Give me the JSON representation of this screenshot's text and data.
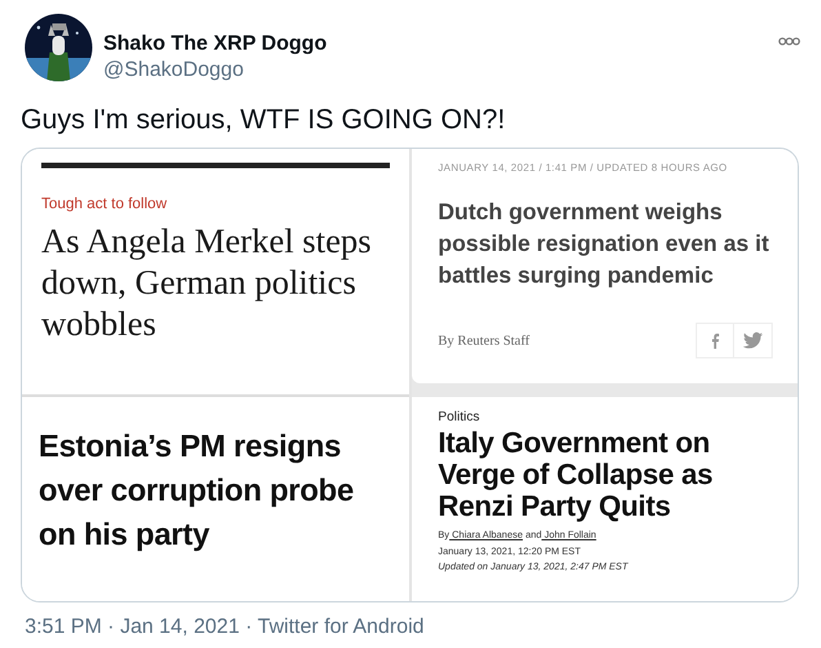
{
  "author": {
    "name": "Shako The XRP Doggo",
    "handle": "@ShakoDoggo"
  },
  "text": "Guys I'm serious, WTF IS GOING ON?!",
  "media": {
    "articles": [
      {
        "kind": "serif",
        "kicker": "Tough act to follow",
        "headline": "As Angela Merkel steps down, German politics wobbles"
      },
      {
        "kind": "wire",
        "dateline": "JANUARY 14, 2021 / 1:41 PM / UPDATED 8 HOURS AGO",
        "headline": "Dutch government weighs possible resignation even as it battles surging pandemic",
        "byline": [
          {
            "text": "By Reuters Staff",
            "link": false
          }
        ]
      },
      {
        "kind": "bold",
        "headline": "Estonia’s PM resigns over corruption probe on his party"
      },
      {
        "kind": "business",
        "kicker": "Politics",
        "headline": "Italy Government on Verge of Collapse as Renzi Party Quits",
        "byline": [
          {
            "text": "By",
            "link": false
          },
          {
            "text": "Chiara Albanese",
            "link": true
          },
          {
            "text": "and",
            "link": false
          },
          {
            "text": "John Follain",
            "link": true
          }
        ],
        "dates": [
          "January 13, 2021, 12:20 PM EST",
          "Updated on  January 13, 2021, 2:47 PM EST"
        ]
      }
    ]
  },
  "footer": "3:51 PM · Jan 14, 2021 · Twitter for Android"
}
